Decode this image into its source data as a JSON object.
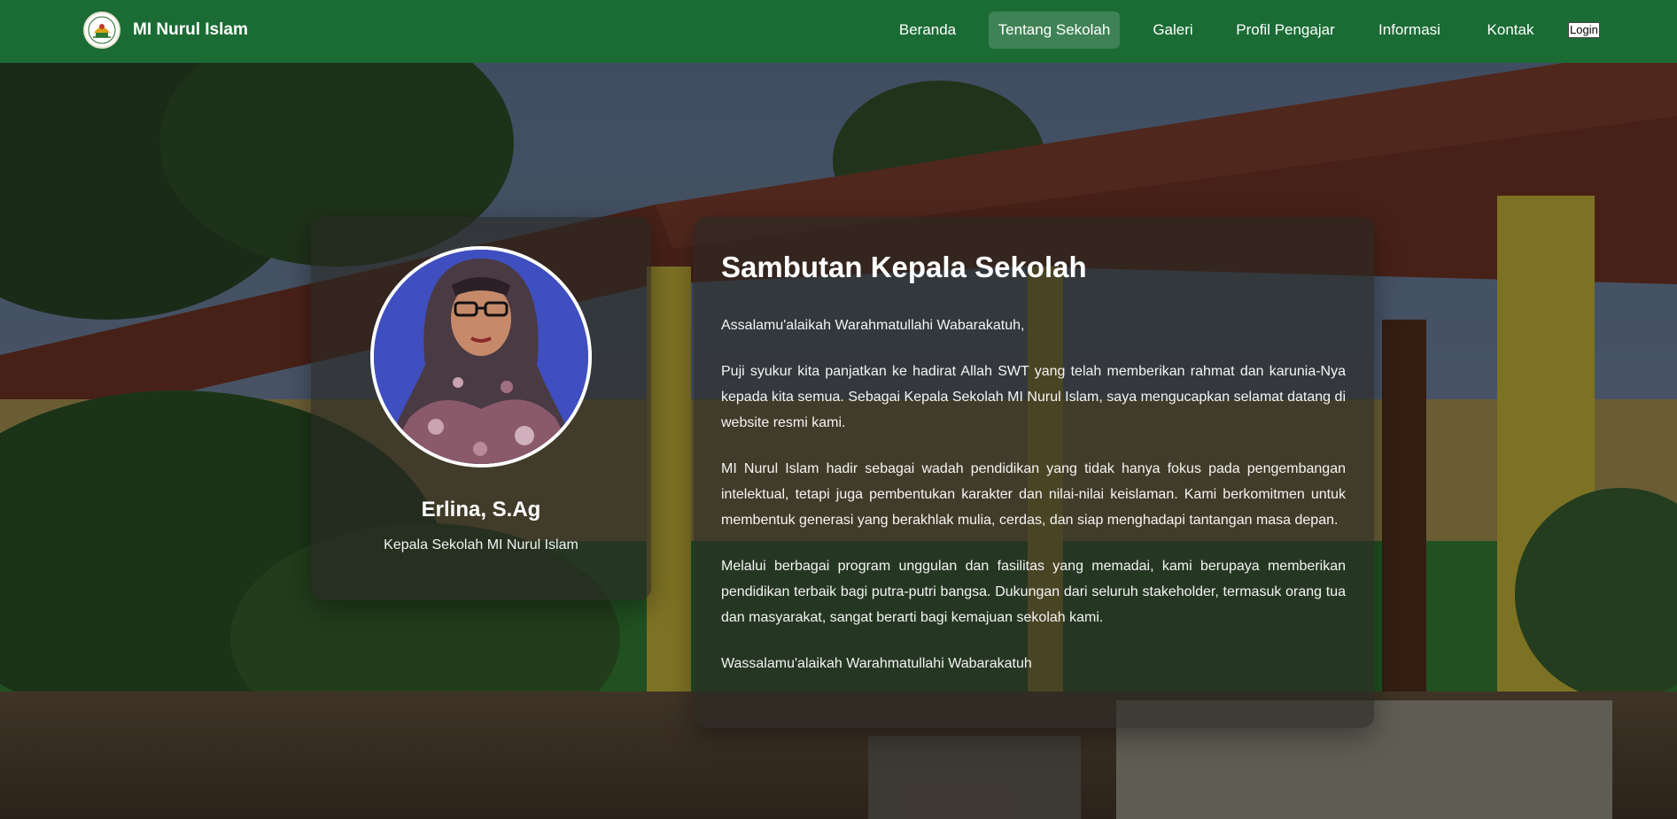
{
  "header": {
    "brand_name": "MI Nurul Islam",
    "logo_icon": "school-logo-icon",
    "nav": [
      {
        "label": "Beranda",
        "active": false
      },
      {
        "label": "Tentang Sekolah",
        "active": true
      },
      {
        "label": "Galeri",
        "active": false
      },
      {
        "label": "Profil Pengajar",
        "active": false
      },
      {
        "label": "Informasi",
        "active": false
      },
      {
        "label": "Kontak",
        "active": false
      }
    ],
    "login_label": "Login",
    "bg_color": "#1b6b35"
  },
  "principal": {
    "name": "Erlina, S.Ag",
    "title": "Kepala Sekolah MI Nurul Islam"
  },
  "welcome": {
    "title": "Sambutan Kepala Sekolah",
    "paragraphs": [
      "Assalamu'alaikah Warahmatullahi Wabarakatuh,",
      "Puji syukur kita panjatkan ke hadirat Allah SWT yang telah memberikan rahmat dan karunia-Nya kepada kita semua. Sebagai Kepala Sekolah MI Nurul Islam, saya mengucapkan selamat datang di website resmi kami.",
      "MI Nurul Islam hadir sebagai wadah pendidikan yang tidak hanya fokus pada pengembangan intelektual, tetapi juga pembentukan karakter dan nilai-nilai keislaman. Kami berkomitmen untuk membentuk generasi yang berakhlak mulia, cerdas, dan siap menghadapi tantangan masa depan.",
      "Melalui berbagai program unggulan dan fasilitas yang memadai, kami berupaya memberikan pendidikan terbaik bagi putra-putri bangsa. Dukungan dari seluruh stakeholder, termasuk orang tua dan masyarakat, sangat berarti bagi kemajuan sekolah kami.",
      "Wassalamu'alaikah Warahmatullahi Wabarakatuh"
    ]
  }
}
